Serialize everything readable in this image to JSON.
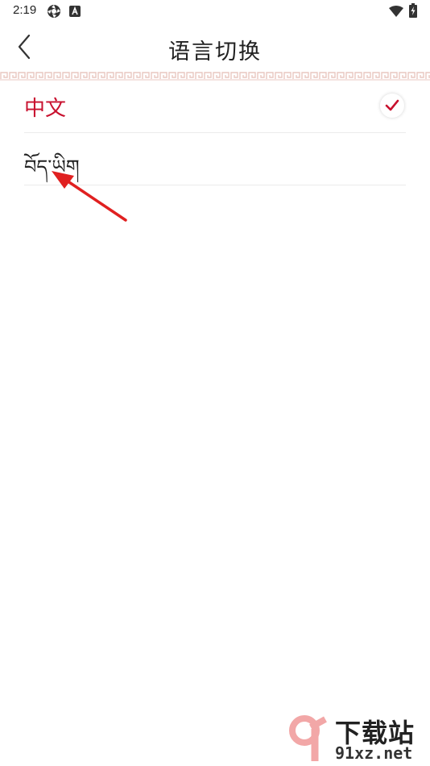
{
  "status_bar": {
    "time": "2:19",
    "icons": [
      "aperture-icon",
      "a-box-icon",
      "wifi-icon",
      "battery-charging-icon"
    ]
  },
  "header": {
    "title": "语言切换",
    "back_icon": "chevron-left-icon"
  },
  "languages": [
    {
      "label": "中文",
      "selected": true
    },
    {
      "label": "བོད་ཡིག",
      "selected": false
    }
  ],
  "colors": {
    "accent": "#c8102e",
    "pattern": "#e9c7c0",
    "divider": "#ececec",
    "arrow": "#e02020"
  },
  "watermark": {
    "top_text": "下载站",
    "bottom_text": "91xz.net"
  }
}
